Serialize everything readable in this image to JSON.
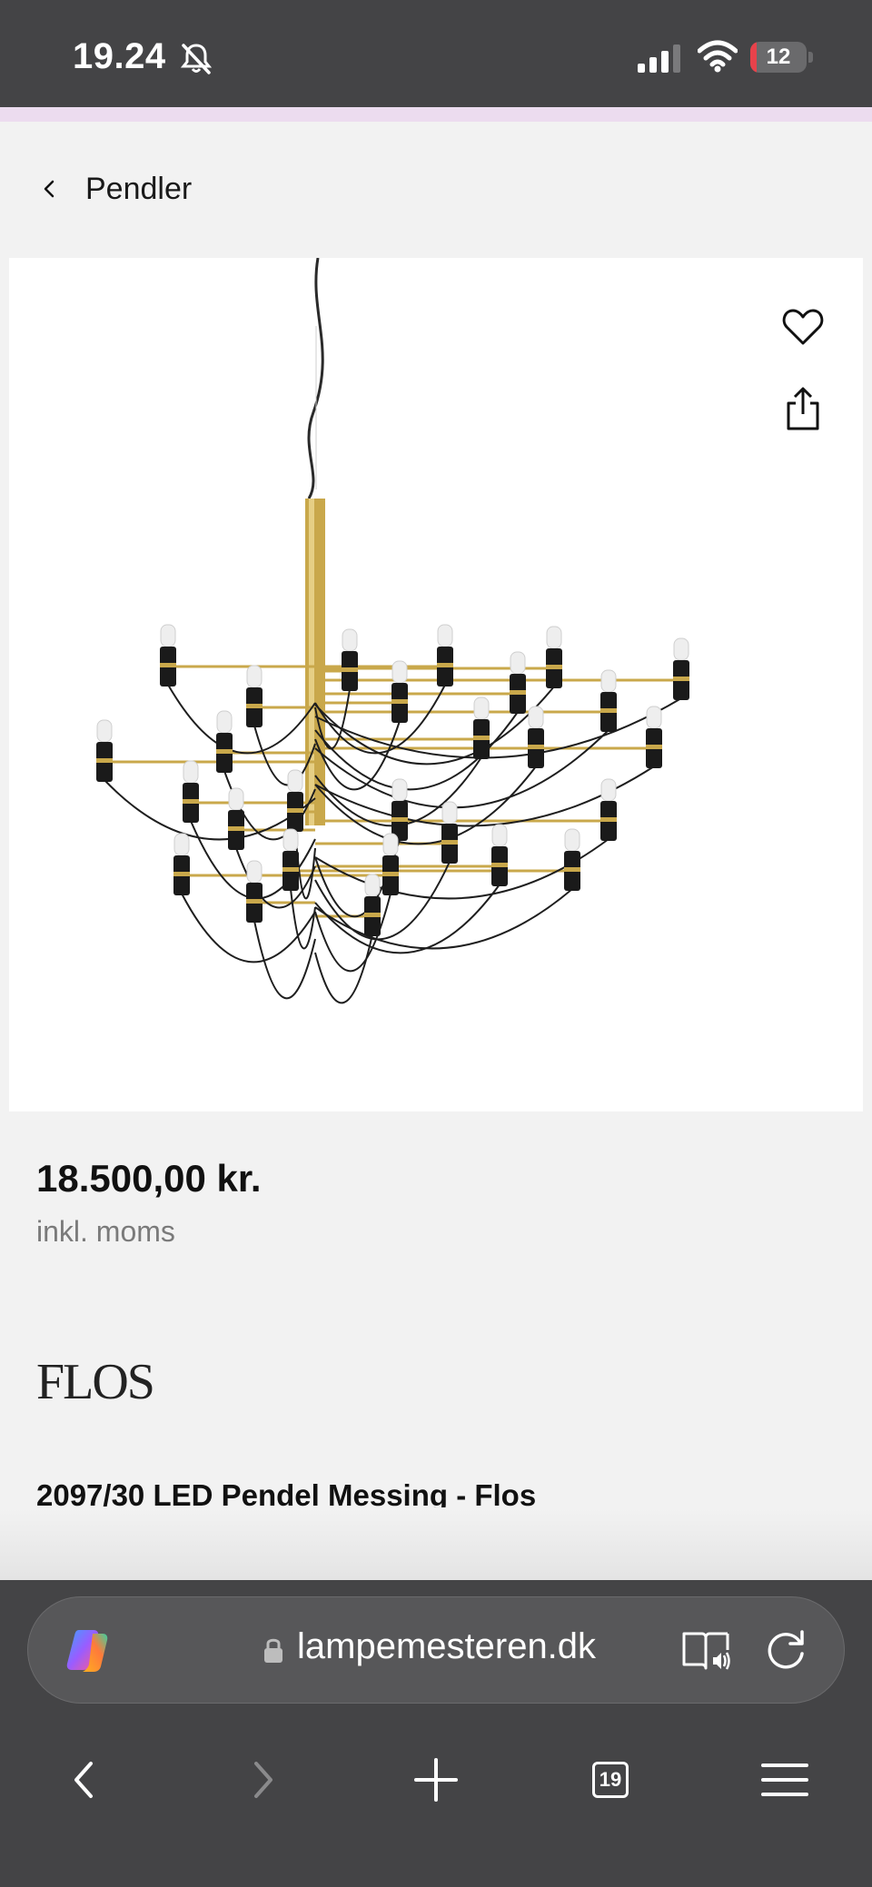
{
  "status_bar": {
    "time": "19.24",
    "battery_level": "12",
    "battery_fraction": 0.12,
    "battery_color": "#e8424b"
  },
  "header": {
    "back_label": "Pendler"
  },
  "product": {
    "image_alt": "chandelier-image",
    "price": "18.500,00 kr.",
    "vat_note": "inkl. moms",
    "brand": "FLOS",
    "title": "2097/30 LED Pendel Messing - Flos"
  },
  "actions": {
    "favorite_icon": "heart-icon",
    "share_icon": "share-icon"
  },
  "browser": {
    "url": "lampemesteren.dk",
    "tab_count": "19",
    "icons": [
      "copilot-icon",
      "lock-icon",
      "reader-mode-icon",
      "reload-icon",
      "back-arrow-icon",
      "forward-arrow-icon",
      "new-tab-icon",
      "tabs-icon",
      "menu-icon"
    ]
  },
  "colors": {
    "status_bar": "#444446",
    "accent_strip": "#ecdcef",
    "page_background": "#f2f2f2",
    "brass": "#c9a84b"
  }
}
